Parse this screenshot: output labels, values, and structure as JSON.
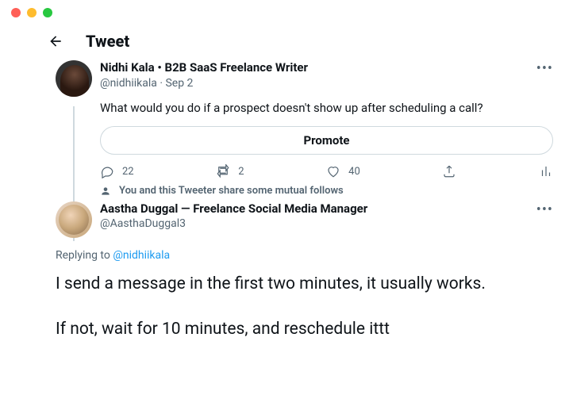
{
  "header": {
    "title": "Tweet"
  },
  "original": {
    "display_name": "Nidhi Kala • B2B SaaS Freelance Writer",
    "handle": "@nidhiikala",
    "date": "Sep 2",
    "text": "What would you do if a prospect doesn't show up after scheduling a call?",
    "promote_label": "Promote",
    "replies": "22",
    "retweets": "2",
    "likes": "40",
    "mutual_text": "You and this Tweeter share some mutual follows"
  },
  "reply": {
    "display_name": "Aastha Duggal — Freelance Social Media Manager",
    "handle": "@AasthaDuggal3",
    "replying_label": "Replying to ",
    "replying_mention": "@nidhiikala",
    "text_p1": "I send a message in the first two minutes, it usually works.",
    "text_p2": "If not, wait for 10 minutes, and reschedule ittt"
  }
}
